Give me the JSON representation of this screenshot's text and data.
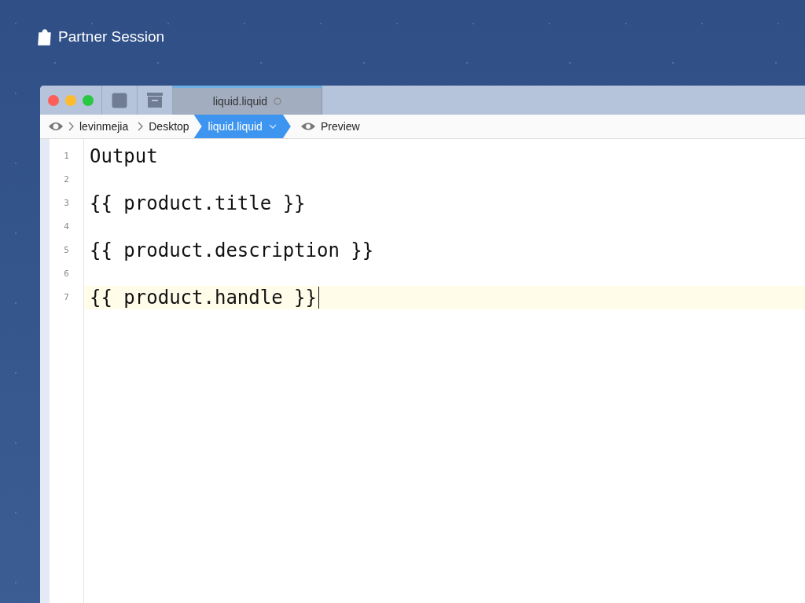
{
  "brand": {
    "title": "Partner Session"
  },
  "window": {
    "tabs": [
      {
        "label": "liquid.liquid",
        "selected": true
      }
    ]
  },
  "breadcrumb": [
    {
      "label": "levinmejia",
      "selected": false
    },
    {
      "label": "Desktop",
      "selected": false
    },
    {
      "label": "liquid.liquid",
      "selected": true
    }
  ],
  "preview": {
    "label": "Preview"
  },
  "editor": {
    "lines": [
      {
        "number": "1",
        "text": "Output",
        "current": false
      },
      {
        "number": "2",
        "current": false
      },
      {
        "number": "3",
        "text": "{{ product.title }}",
        "current": false
      },
      {
        "number": "4",
        "current": false
      },
      {
        "number": "5",
        "text": "{{ product.description }}",
        "current": false
      },
      {
        "number": "6",
        "current": false
      },
      {
        "number": "7",
        "text": "{{ product.handle }}",
        "current": true
      }
    ]
  }
}
